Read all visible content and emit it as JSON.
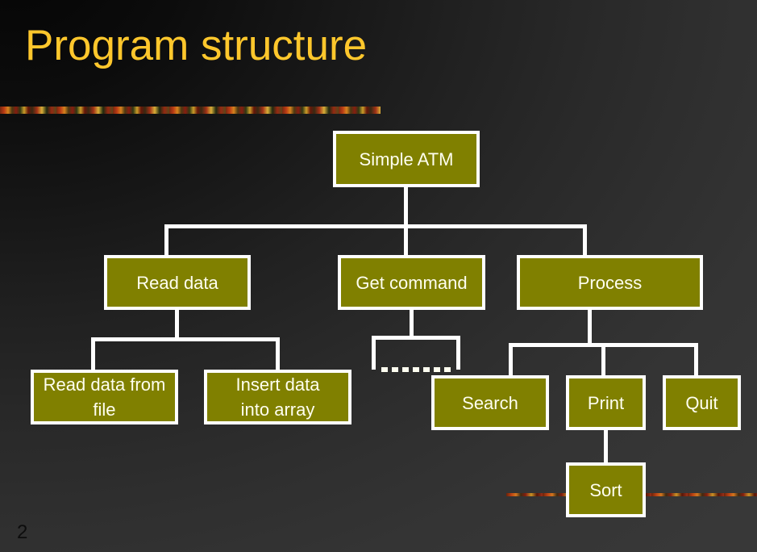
{
  "slide": {
    "title": "Program structure",
    "page_number": "2",
    "title_color": "#FFC72C",
    "node_fill_color": "#808000",
    "node_border_color": "#FFFFFF",
    "node_text_color": "#FFFFF0",
    "connector_color": "#FFFFFF",
    "background_color": "#2e2e2e"
  },
  "diagram": {
    "type": "tree",
    "root": "Simple ATM",
    "nodes": [
      {
        "id": "simple-atm",
        "label": "Simple ATM",
        "level": 1
      },
      {
        "id": "read-data",
        "label": "Read data",
        "level": 2
      },
      {
        "id": "get-command",
        "label": "Get command",
        "level": 2
      },
      {
        "id": "process",
        "label": "Process",
        "level": 2
      },
      {
        "id": "read-data-from-file",
        "label": "Read data from\nfile",
        "level": 3
      },
      {
        "id": "insert-data-into-array",
        "label": "Insert data\ninto array",
        "level": 3
      },
      {
        "id": "search",
        "label": "Search",
        "level": 3
      },
      {
        "id": "print",
        "label": "Print",
        "level": 3
      },
      {
        "id": "quit",
        "label": "Quit",
        "level": 3
      },
      {
        "id": "sort",
        "label": "Sort",
        "level": 4
      }
    ],
    "edges": [
      {
        "from": "simple-atm",
        "to": "read-data",
        "style": "solid"
      },
      {
        "from": "simple-atm",
        "to": "get-command",
        "style": "solid"
      },
      {
        "from": "simple-atm",
        "to": "process",
        "style": "solid"
      },
      {
        "from": "read-data",
        "to": "read-data-from-file",
        "style": "solid"
      },
      {
        "from": "read-data",
        "to": "insert-data-into-array",
        "style": "solid"
      },
      {
        "from": "get-command",
        "to": "placeholder",
        "style": "dashed"
      },
      {
        "from": "process",
        "to": "search",
        "style": "solid"
      },
      {
        "from": "process",
        "to": "print",
        "style": "solid"
      },
      {
        "from": "process",
        "to": "quit",
        "style": "solid"
      },
      {
        "from": "print",
        "to": "sort",
        "style": "solid"
      }
    ]
  }
}
